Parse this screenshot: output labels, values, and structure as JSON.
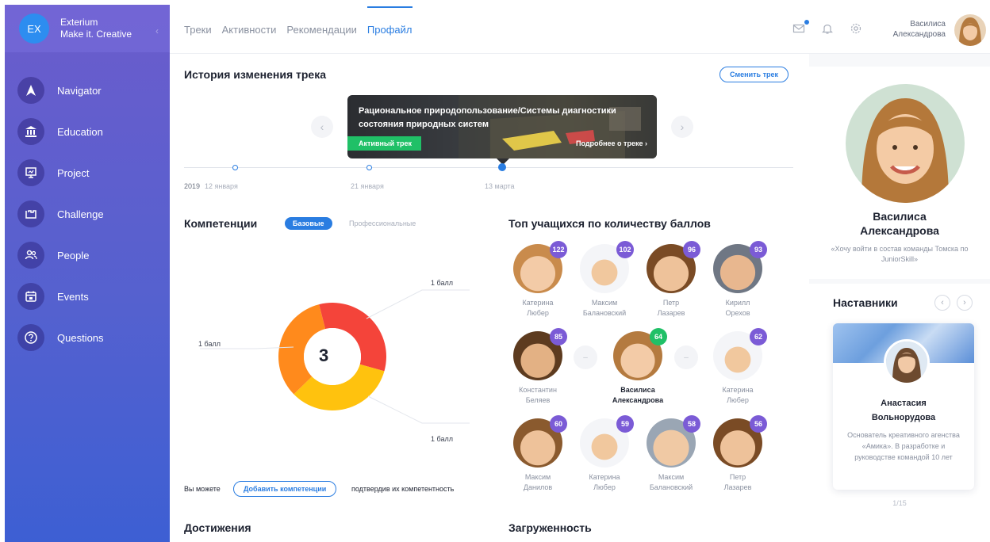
{
  "brand": {
    "logo": "EX",
    "name": "Exterium",
    "tagline": "Make it. Creative"
  },
  "sidebar": {
    "items": [
      {
        "label": "Navigator",
        "icon": "navigator-icon"
      },
      {
        "label": "Education",
        "icon": "education-icon"
      },
      {
        "label": "Project",
        "icon": "project-icon"
      },
      {
        "label": "Challenge",
        "icon": "challenge-icon"
      },
      {
        "label": "People",
        "icon": "people-icon"
      },
      {
        "label": "Events",
        "icon": "events-icon"
      },
      {
        "label": "Questions",
        "icon": "questions-icon"
      }
    ]
  },
  "header": {
    "tabs": [
      "Треки",
      "Активности",
      "Рекомендации",
      "Профайл"
    ],
    "active_tab": "Профайл",
    "user": {
      "first": "Василиса",
      "last": "Александрова"
    }
  },
  "track_history": {
    "title": "История изменения трека",
    "change_button": "Сменить трек",
    "card_title": "Рациональное природопользование/Системы диагностики состояния природных систем",
    "card_badge": "Активный трек",
    "card_more": "Подробнее о треке",
    "year": "2019",
    "dates": [
      "12 января",
      "21 января",
      "13 марта"
    ]
  },
  "competencies": {
    "title": "Компетенции",
    "tab_basic": "Базовые",
    "tab_professional": "Профессиональные",
    "center_value": "3",
    "segments": [
      {
        "label": "1 балл",
        "value": 1,
        "color": "#f4443a"
      },
      {
        "label": "1 балл",
        "value": 1,
        "color": "#ffc20e"
      },
      {
        "label": "1 балл",
        "value": 1,
        "color": "#ff8a1c"
      }
    ],
    "footer_prefix": "Вы можете",
    "add_button": "Добавить компетенции",
    "footer_suffix": "подтвердив их компетентность"
  },
  "top_students": {
    "title": "Топ учащихся по количеству баллов",
    "rows": [
      [
        {
          "first": "Катерина",
          "last": "Любер",
          "score": "122"
        },
        {
          "first": "Максим",
          "last": "Балановский",
          "score": "102"
        },
        {
          "first": "Петр",
          "last": "Лазарев",
          "score": "96"
        },
        {
          "first": "Кирилл",
          "last": "Орехов",
          "score": "93"
        }
      ],
      [
        {
          "first": "Константин",
          "last": "Беляев",
          "score": "85"
        },
        {
          "first": "Василиса",
          "last": "Александрова",
          "score": "64",
          "me": true
        },
        {
          "first": "Катерина",
          "last": "Любер",
          "score": "62"
        }
      ],
      [
        {
          "first": "Максим",
          "last": "Данилов",
          "score": "60"
        },
        {
          "first": "Катерина",
          "last": "Любер",
          "score": "59"
        },
        {
          "first": "Максим",
          "last": "Балановский",
          "score": "58"
        },
        {
          "first": "Петр",
          "last": "Лазарев",
          "score": "56"
        }
      ]
    ],
    "dash": "–"
  },
  "sections": {
    "achievements": "Достижения",
    "workload": "Загруженность"
  },
  "profile": {
    "name_first": "Василиса",
    "name_last": "Александрова",
    "quote": "«Хочу войти в состав команды Томска по JuniorSkill»"
  },
  "mentors": {
    "title": "Наставники",
    "name_first": "Анастасия",
    "name_last": "Вольнорудова",
    "description": "Основатель креативного агенства «Амика». В разработке и руководстве командой 10 лет",
    "pager": "1/15"
  }
}
